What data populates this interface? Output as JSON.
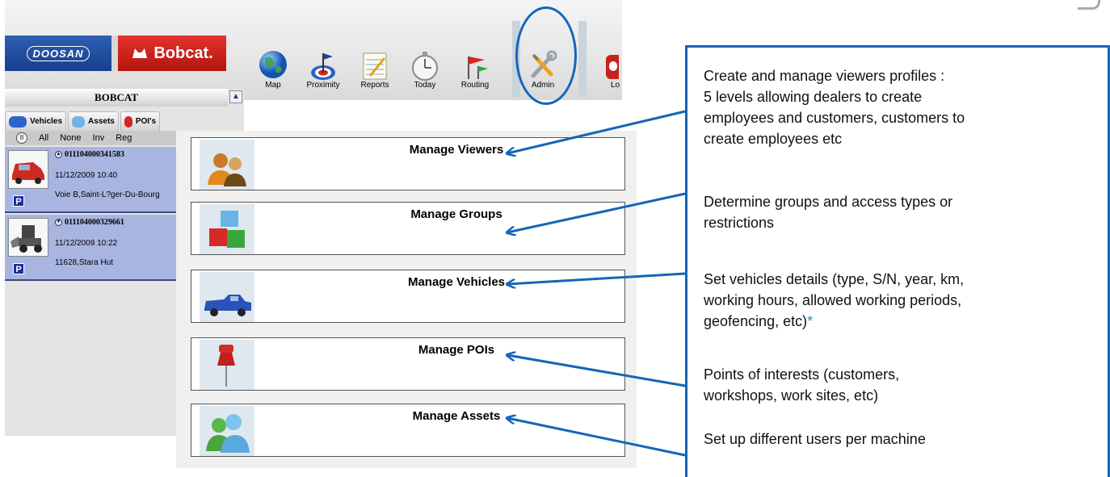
{
  "brand": {
    "doosan_logo": "DOOSAN",
    "bobcat_logo": "Bobcat."
  },
  "toolbar": {
    "items": [
      {
        "label": "Map",
        "icon": "globe-icon"
      },
      {
        "label": "Proximity",
        "icon": "target-flag-icon"
      },
      {
        "label": "Reports",
        "icon": "notepad-icon"
      },
      {
        "label": "Today",
        "icon": "stopwatch-icon"
      },
      {
        "label": "Routing",
        "icon": "route-flags-icon"
      },
      {
        "label": "Admin",
        "icon": "wrench-screwdriver-icon",
        "selected": true
      },
      {
        "label": "Lo",
        "icon": "logout-icon"
      }
    ]
  },
  "left_panel": {
    "title": "BOBCAT",
    "tabs": [
      "Vehicles",
      "Assets",
      "POI's"
    ],
    "filters": [
      "All",
      "None",
      "Inv",
      "Reg"
    ],
    "vehicles": [
      {
        "id": "011104000341583",
        "datetime": "11/12/2009 10:40",
        "location": "Voie B,Saint-L?ger-Du-Bourg",
        "badge": "P"
      },
      {
        "id": "011104000329661",
        "datetime": "11/12/2009 10:22",
        "location": "11628,Stara Hut",
        "badge": "P"
      }
    ]
  },
  "admin_menu": {
    "items": [
      {
        "label": "Manage Viewers",
        "icon": "viewers-people-icon"
      },
      {
        "label": "Manage Groups",
        "icon": "cubes-icon"
      },
      {
        "label": "Manage Vehicles",
        "icon": "pickup-truck-icon"
      },
      {
        "label": "Manage POIs",
        "icon": "push-pin-icon"
      },
      {
        "label": "Manage Assets",
        "icon": "users-icon"
      }
    ]
  },
  "callout": {
    "viewers_line1": "Create and manage viewers profiles :",
    "viewers_line2": "5 levels allowing dealers to create",
    "viewers_line3": "employees and customers, customers to",
    "viewers_line4": "create employees etc",
    "groups_line1": "Determine groups and access types or",
    "groups_line2": "restrictions",
    "vehicles_line1": "Set vehicles details (type, S/N, year, km,",
    "vehicles_line2": "working hours, allowed working periods,",
    "vehicles_line3": "geofencing, etc)",
    "vehicles_star": "*",
    "pois_line1": "Points of interests (customers,",
    "pois_line2": "workshops, work sites, etc)",
    "assets_line1": "Set up different users per machine"
  },
  "colors": {
    "accent_blue": "#1565b8",
    "doosan_blue": "#1f4fa0",
    "bobcat_red": "#d42a23",
    "vehicle_row_bg": "#a8b5e0",
    "star_blue": "#1a8fd6"
  }
}
